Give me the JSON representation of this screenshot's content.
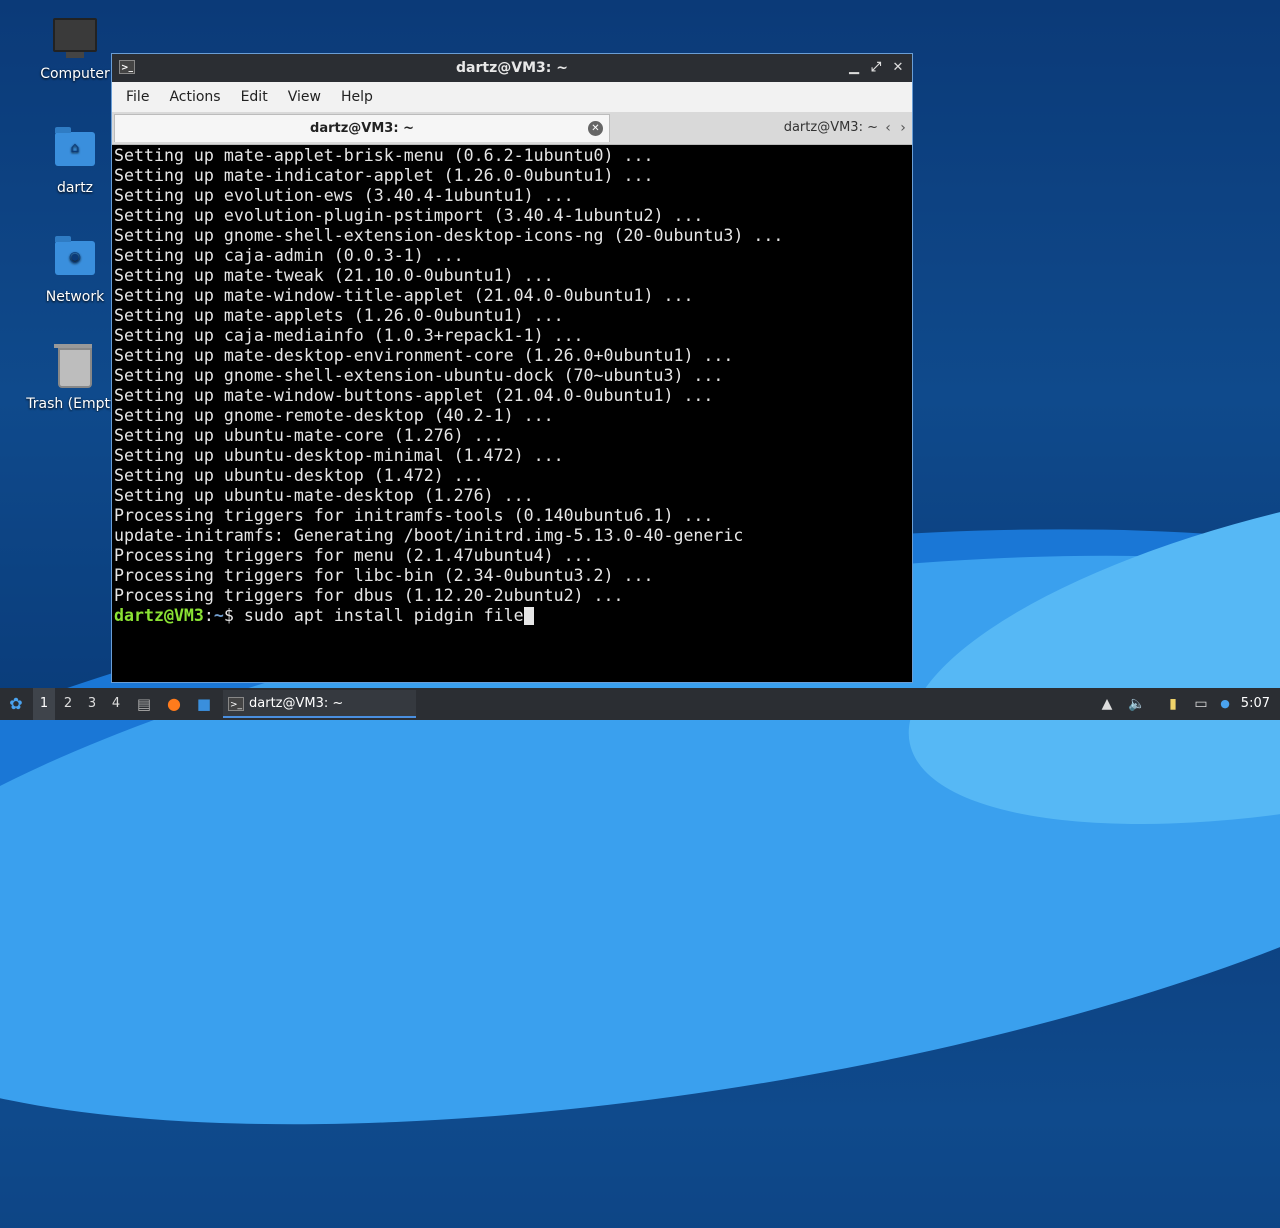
{
  "desktop": {
    "icons": [
      {
        "label": "Computer"
      },
      {
        "label": "dartz"
      },
      {
        "label": "Network"
      },
      {
        "label": "Trash (Empty)"
      }
    ]
  },
  "window": {
    "title": "dartz@VM3: ~",
    "menu": [
      "File",
      "Actions",
      "Edit",
      "View",
      "Help"
    ],
    "tabs": [
      {
        "label": "dartz@VM3: ~",
        "active": true
      },
      {
        "label": "dartz@VM3: ~",
        "active": false
      }
    ]
  },
  "terminal": {
    "lines": [
      "Setting up mate-applet-brisk-menu (0.6.2-1ubuntu0) ...",
      "Setting up mate-indicator-applet (1.26.0-0ubuntu1) ...",
      "Setting up evolution-ews (3.40.4-1ubuntu1) ...",
      "Setting up evolution-plugin-pstimport (3.40.4-1ubuntu2) ...",
      "Setting up gnome-shell-extension-desktop-icons-ng (20-0ubuntu3) ...",
      "Setting up caja-admin (0.0.3-1) ...",
      "Setting up mate-tweak (21.10.0-0ubuntu1) ...",
      "Setting up mate-window-title-applet (21.04.0-0ubuntu1) ...",
      "Setting up mate-applets (1.26.0-0ubuntu1) ...",
      "Setting up caja-mediainfo (1.0.3+repack1-1) ...",
      "Setting up mate-desktop-environment-core (1.26.0+0ubuntu1) ...",
      "Setting up gnome-shell-extension-ubuntu-dock (70~ubuntu3) ...",
      "Setting up mate-window-buttons-applet (21.04.0-0ubuntu1) ...",
      "Setting up gnome-remote-desktop (40.2-1) ...",
      "Setting up ubuntu-mate-core (1.276) ...",
      "Setting up ubuntu-desktop-minimal (1.472) ...",
      "Setting up ubuntu-desktop (1.472) ...",
      "Setting up ubuntu-mate-desktop (1.276) ...",
      "Processing triggers for initramfs-tools (0.140ubuntu6.1) ...",
      "update-initramfs: Generating /boot/initrd.img-5.13.0-40-generic",
      "Processing triggers for menu (2.1.47ubuntu4) ...",
      "Processing triggers for libc-bin (2.34-0ubuntu3.2) ...",
      "Processing triggers for dbus (1.12.20-2ubuntu2) ..."
    ],
    "prompt_user": "dartz@VM3",
    "prompt_sep": ":",
    "prompt_path": "~",
    "prompt_symbol": "$ ",
    "command": "sudo apt install pidgin file"
  },
  "taskbar": {
    "workspaces": [
      "1",
      "2",
      "3",
      "4"
    ],
    "active_workspace": "1",
    "task_label": "dartz@VM3: ~",
    "clock": "5:07"
  }
}
